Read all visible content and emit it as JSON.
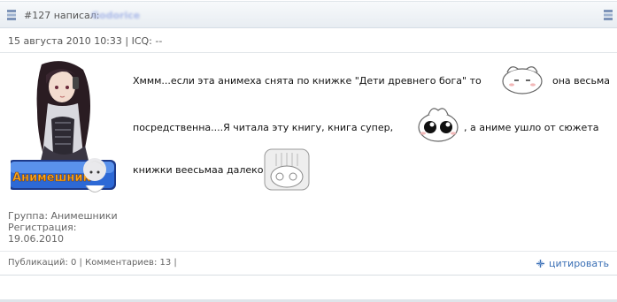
{
  "post": {
    "number_label": "#127 написал:",
    "author": "Godorice",
    "meta": "15 августа 2010 10:33 | ICQ: --"
  },
  "user": {
    "badge_text": "Анимешник",
    "group": "Группа: Анимешники",
    "registration_label": "Регистрация:",
    "registration_date": "19.06.2010"
  },
  "message": {
    "line1": "Хммм...если эта анимеха снята по книжке \"Дети древнего бога\" то",
    "line1_tail": "она весьма",
    "line2": "посредственна....Я читала эту книгу, книга супер,",
    "line2_tail": ", а аниме ушло от сюжета",
    "line3": "книжки веесьмаа далеко"
  },
  "footer": {
    "stats": "Публикаций: 0 | Комментариев: 13 |",
    "quote_label": "цитировать"
  },
  "colors": {
    "link": "#3a6fb5",
    "header_bg": "#e8edf2"
  }
}
